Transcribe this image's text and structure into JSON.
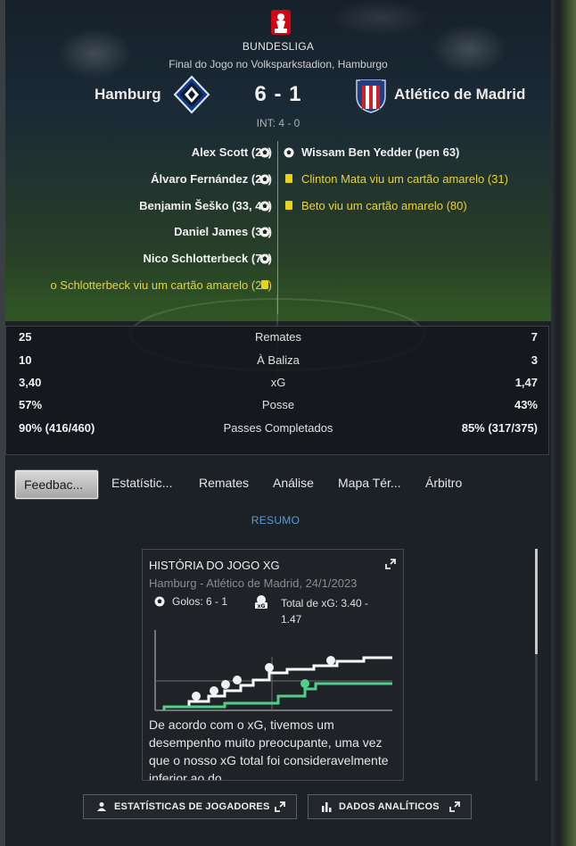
{
  "header": {
    "league": "BUNDESLIGA",
    "venue": "Final do Jogo no Volksparkstadion, Hamburgo",
    "home_team": "Hamburg",
    "away_team": "Atlético de Madrid",
    "score": "6 - 1",
    "half_time": "INT: 4 - 0"
  },
  "events": {
    "home": [
      {
        "text": "Alex Scott (22)",
        "type": "goal"
      },
      {
        "text": "Álvaro Fernández (29)",
        "type": "goal"
      },
      {
        "text": "Benjamin Šeško (33, 49)",
        "type": "goal"
      },
      {
        "text": "Daniel James (38)",
        "type": "goal"
      },
      {
        "text": "Nico Schlotterbeck (74)",
        "type": "goal"
      },
      {
        "text": "o Schlotterbeck viu um cartão amarelo (26)",
        "type": "yellow"
      }
    ],
    "away": [
      {
        "text": "Wissam Ben Yedder (pen 63)",
        "type": "goal"
      },
      {
        "text": "Clinton Mata viu um cartão amarelo (31)",
        "type": "yellow"
      },
      {
        "text": "Beto viu um cartão amarelo (80)",
        "type": "yellow"
      }
    ]
  },
  "stats": [
    {
      "label": "Remates",
      "home": "25",
      "away": "7"
    },
    {
      "label": "À Baliza",
      "home": "10",
      "away": "3"
    },
    {
      "label": "xG",
      "home": "3,40",
      "away": "1,47"
    },
    {
      "label": "Posse",
      "home": "57%",
      "away": "43%"
    },
    {
      "label": "Passes Completados",
      "home": "90% (416/460)",
      "away": "85% (317/375)"
    }
  ],
  "tabs": [
    "Feedbac...",
    "Estatístic...",
    "Remates",
    "Análise",
    "Mapa Tér...",
    "Árbitro"
  ],
  "active_tab": "Feedbac...",
  "summary_label": "RESUMO",
  "card": {
    "title": "HISTÓRIA DO JOGO XG",
    "subtitle": "Hamburg - Atlético de Madrid, 24/1/2023",
    "goals": "Golos: 6 - 1",
    "xg_total": "Total de xG: 3.40 - 1.47",
    "text": "De acordo com o xG, tivemos um desempenho muito preocupante, uma vez que o nosso xG total foi consideravelmente inferior ao do"
  },
  "buttons": {
    "player_stats": "ESTATÍSTICAS DE JOGADORES",
    "analytics": "DADOS ANALÍTICOS"
  },
  "colors": {
    "yellow_card": "#e8d21b",
    "summary_link": "#5b9bd5",
    "home_xg_line": "#ffffff",
    "away_xg_line": "#4fd08a"
  }
}
